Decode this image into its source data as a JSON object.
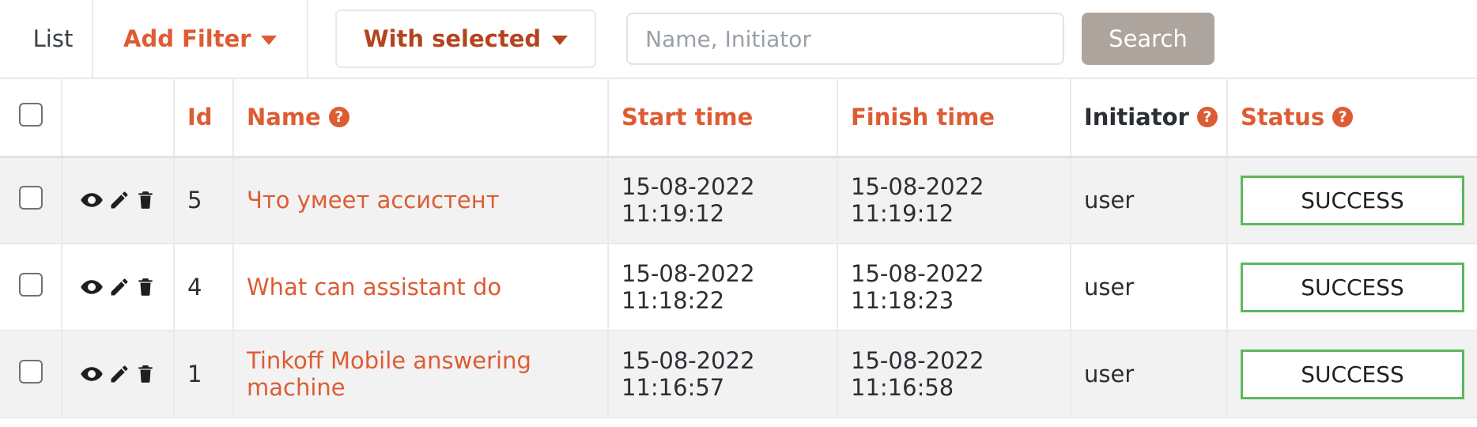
{
  "toolbar": {
    "list_label": "List",
    "add_filter_label": "Add Filter",
    "with_selected_label": "With selected",
    "search_placeholder": "Name, Initiator",
    "search_value": "",
    "search_button_label": "Search"
  },
  "colors": {
    "accent_orange": "#dd5c33",
    "dark_orange": "#b4441f",
    "search_button_bg": "#ada49e",
    "success_border": "#5cb85c",
    "row_stripe": "#f2f2f2"
  },
  "table": {
    "columns": [
      {
        "key": "checkbox",
        "label": "",
        "help": false
      },
      {
        "key": "actions",
        "label": "",
        "help": false
      },
      {
        "key": "id",
        "label": "Id",
        "help": false
      },
      {
        "key": "name",
        "label": "Name",
        "help": true
      },
      {
        "key": "start_time",
        "label": "Start time",
        "help": false
      },
      {
        "key": "finish_time",
        "label": "Finish time",
        "help": false
      },
      {
        "key": "initiator",
        "label": "Initiator",
        "help": true
      },
      {
        "key": "status",
        "label": "Status",
        "help": true
      }
    ],
    "help_glyph": "?",
    "row_actions": [
      "view-icon",
      "edit-icon",
      "delete-icon"
    ],
    "rows": [
      {
        "id": "5",
        "name": "Что умеет ассистент",
        "start_time": "15-08-2022 11:19:12",
        "finish_time": "15-08-2022 11:19:12",
        "initiator": "user",
        "status": "SUCCESS"
      },
      {
        "id": "4",
        "name": "What can assistant do",
        "start_time": "15-08-2022 11:18:22",
        "finish_time": "15-08-2022 11:18:23",
        "initiator": "user",
        "status": "SUCCESS"
      },
      {
        "id": "1",
        "name": "Tinkoff Mobile answering machine",
        "start_time": "15-08-2022 11:16:57",
        "finish_time": "15-08-2022 11:16:58",
        "initiator": "user",
        "status": "SUCCESS"
      }
    ]
  }
}
